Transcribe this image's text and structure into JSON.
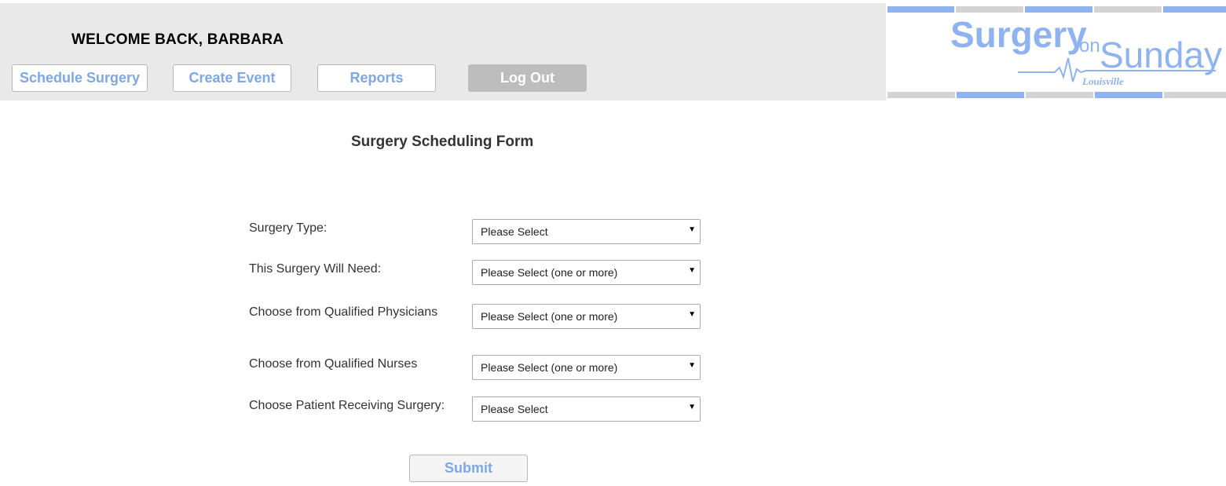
{
  "header": {
    "welcome": "WELCOME BACK, BARBARA",
    "nav": {
      "schedule_surgery": "Schedule Surgery",
      "create_event": "Create Event",
      "reports": "Reports",
      "log_out": "Log Out"
    }
  },
  "logo": {
    "text_surgery": "Surgery",
    "text_on": "on",
    "text_sunday": "Sunday",
    "text_city": "Louisville",
    "color_primary": "#8fb3ef",
    "color_stripe_gray": "#d3d3d3"
  },
  "form": {
    "title": "Surgery Scheduling Form",
    "fields": [
      {
        "label": "Surgery Type:",
        "value": "Please Select"
      },
      {
        "label": "This Surgery Will Need:",
        "value": "Please Select (one or more)"
      },
      {
        "label": "Choose from Qualified Physicians",
        "value": "Please Select (one or more)"
      },
      {
        "label": "Choose from Qualified Nurses",
        "value": "Please Select (one or more)"
      },
      {
        "label": "Choose Patient Receiving Surgery:",
        "value": "Please Select"
      }
    ],
    "dropdown_icon": "caret-down-icon",
    "submit_label": "Submit"
  },
  "colors": {
    "accent": "#7ea7e4",
    "header_bg": "#e9e9e9",
    "logout_bg": "#bdbdbd"
  }
}
